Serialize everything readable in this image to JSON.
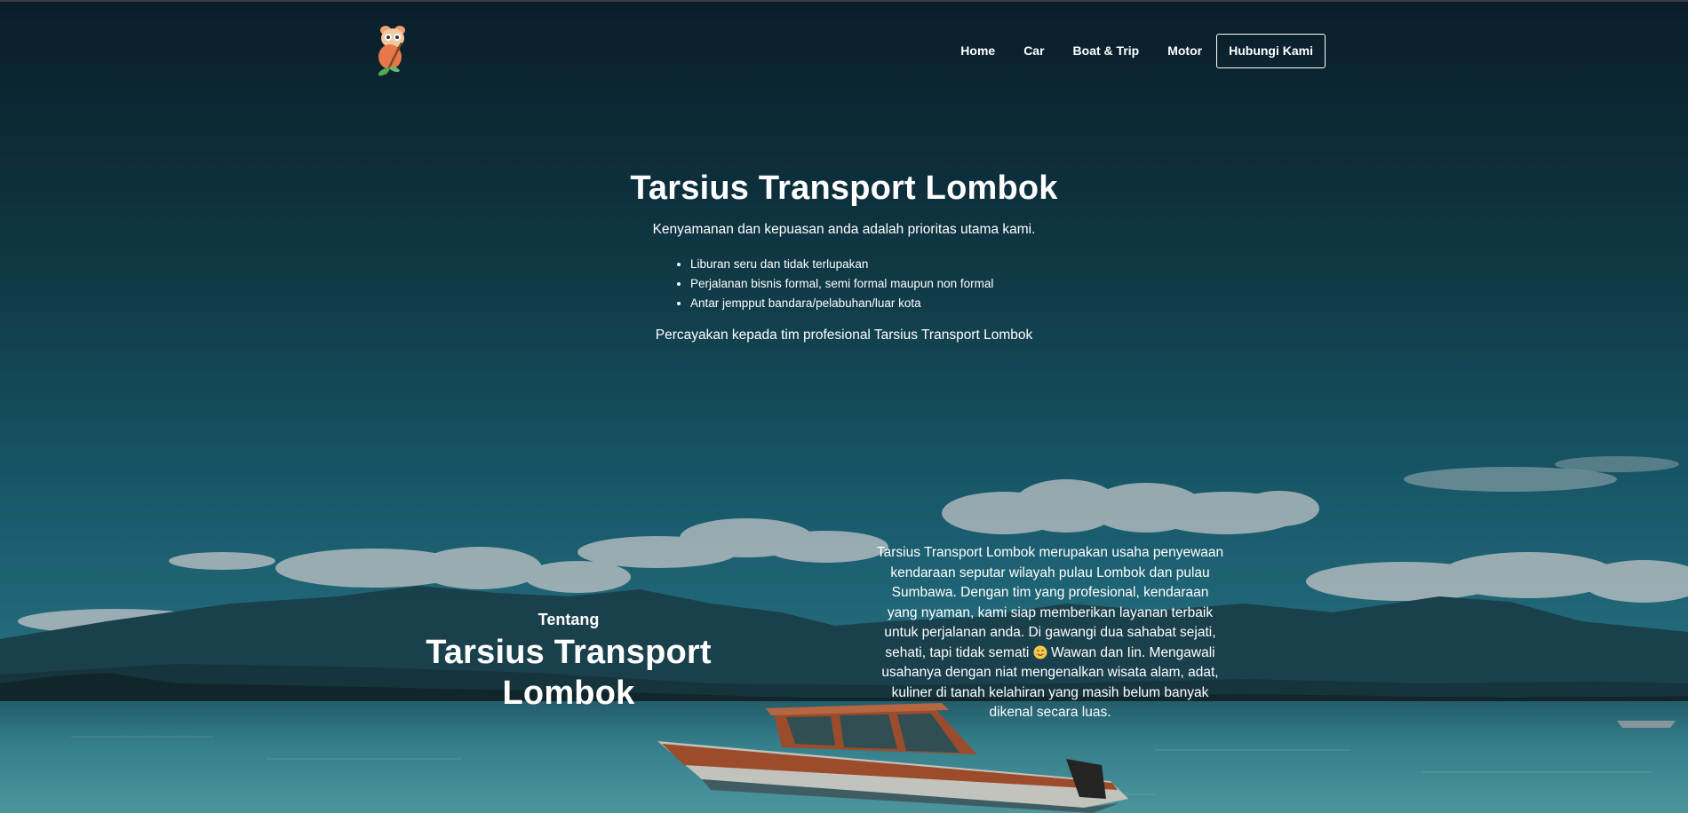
{
  "header": {
    "logo_icon": "tarsier-logo-icon",
    "nav": [
      {
        "label": "Home"
      },
      {
        "label": "Car"
      },
      {
        "label": "Boat & Trip"
      },
      {
        "label": "Motor"
      }
    ],
    "cta_label": "Hubungi Kami"
  },
  "hero": {
    "title": "Tarsius Transport Lombok",
    "subtitle": "Kenyamanan dan kepuasan anda adalah prioritas utama kami.",
    "bullets": [
      "Liburan seru dan tidak terlupakan",
      "Perjalanan bisnis formal, semi formal maupun non formal",
      "Antar jempput bandara/pelabuhan/luar kota"
    ],
    "trust_line": "Percayakan kepada tim profesional Tarsius Transport Lombok"
  },
  "about": {
    "kicker": "Tentang",
    "title": "Tarsius Transport Lombok",
    "text_before_emoji": "Tarsius Transport Lombok merupakan usaha penyewaan kendaraan seputar wilayah pulau Lombok dan pulau Sumbawa. Dengan tim yang profesional, kendaraan yang nyaman, kami siap memberikan layanan terbaik untuk perjalanan anda. Di gawangi dua sahabat sejati, sehati, tapi tidak semati",
    "emoji_icon": "smiling-face-icon",
    "text_after_emoji": " Wawan dan Iin. Mengawali usahanya dengan niat mengenalkan wisata alam, adat, kuliner di tanah kelahiran yang masih belum banyak dikenal secara luas."
  },
  "background": {
    "scene_icon": "lombok-sea-boat-icon",
    "colors": {
      "sky_top": "#0f2f3d",
      "sky_mid": "#1d6b80",
      "sea": "#3d96a6",
      "boat_hull": "#b85a33"
    }
  }
}
